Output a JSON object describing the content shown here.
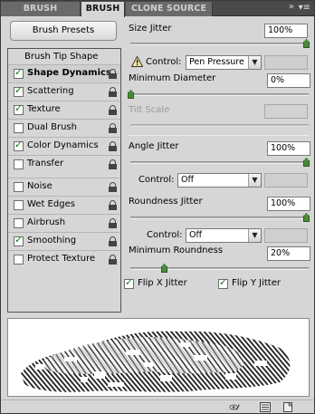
{
  "tabs": [
    {
      "label": "BRUSH PRESETS",
      "active": false
    },
    {
      "label": "BRUSH",
      "active": true
    },
    {
      "label": "CLONE SOURCE",
      "active": false
    }
  ],
  "tab_controls": {
    "collapse_icon": "double-arrow-icon",
    "menu_icon": "panel-menu-icon"
  },
  "brush_presets_button": "Brush Presets",
  "left_list": {
    "header": "Brush Tip Shape",
    "items": [
      {
        "label": "Shape Dynamics",
        "checked": true,
        "active": true
      },
      {
        "label": "Scattering",
        "checked": true,
        "active": false
      },
      {
        "label": "Texture",
        "checked": true,
        "active": false
      },
      {
        "label": "Dual Brush",
        "checked": false,
        "active": false
      },
      {
        "label": "Color Dynamics",
        "checked": true,
        "active": false
      },
      {
        "label": "Transfer",
        "checked": false,
        "active": false
      },
      {
        "label": "Noise",
        "checked": false,
        "active": false
      },
      {
        "label": "Wet Edges",
        "checked": false,
        "active": false
      },
      {
        "label": "Airbrush",
        "checked": false,
        "active": false
      },
      {
        "label": "Smoothing",
        "checked": true,
        "active": false
      },
      {
        "label": "Protect Texture",
        "checked": false,
        "active": false
      }
    ]
  },
  "size_jitter": {
    "label": "Size Jitter",
    "value": "100%",
    "slider": 1.0
  },
  "size_control": {
    "label": "Control:",
    "value": "Pen Pressure"
  },
  "minimum_diameter": {
    "label": "Minimum Diameter",
    "value": "0%",
    "slider": 0.0
  },
  "tilt_scale": {
    "label": "Tilt Scale",
    "value": ""
  },
  "angle_jitter": {
    "label": "Angle Jitter",
    "value": "100%",
    "slider": 1.0
  },
  "angle_control": {
    "label": "Control:",
    "value": "Off"
  },
  "roundness_jitter": {
    "label": "Roundness Jitter",
    "value": "100%",
    "slider": 1.0
  },
  "roundness_control": {
    "label": "Control:",
    "value": "Off"
  },
  "minimum_roundness": {
    "label": "Minimum Roundness",
    "value": "20%",
    "slider": 0.2
  },
  "flip_x": {
    "label": "Flip X Jitter",
    "checked": true
  },
  "flip_y": {
    "label": "Flip Y Jitter",
    "checked": true
  },
  "bottom_icons": [
    "eye-brush-icon",
    "panel-grid-icon",
    "new-preset-icon"
  ],
  "colors": {
    "accent_green": "#4a8a3a",
    "tab_bg": "#4a4a4a",
    "panel_bg": "#d6d6d6"
  }
}
